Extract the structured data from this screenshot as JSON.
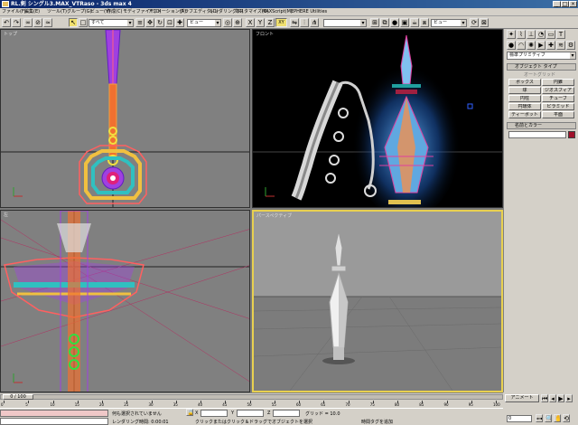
{
  "window": {
    "title": "RL.剣 シングル3.MAX_VTRaso - 3ds max 4"
  },
  "menu": [
    "ファイル(F)",
    "編集(E)",
    "ツール(T)",
    "グループ(G)",
    "ビュー(V)",
    "作成(C)",
    "モディファイヤ(O)",
    "アニメーション(A)",
    "グラフエディタ(D)",
    "レンダリング(R)",
    "カスタマイズ(U)",
    "MAXScript(M)",
    "EPHERE Utilities"
  ],
  "toolbar": {
    "selection_filter": "すべて",
    "ref_coord": "ビュー",
    "axis_x": "X",
    "axis_y": "Y",
    "axis_z": "Z",
    "axis_xy": "XY",
    "named_sel": "",
    "render_type": "ビュー"
  },
  "viewports": {
    "top_label": "トップ",
    "front_label": "フロント",
    "left_label": "左",
    "persp_label": "パースペクティブ"
  },
  "command_panel": {
    "category_dropdown": "標準プリミティブ",
    "rollout_object_type": "オブジェクト タイプ",
    "autogrid_label": "オートグリッド",
    "buttons": [
      "ボックス",
      "円錐",
      "球",
      "ジオスフィア",
      "円柱",
      "チューブ",
      "円環体",
      "ピラミッド",
      "ティーポット",
      "平面"
    ],
    "rollout_name_color": "名前とカラー"
  },
  "timeline": {
    "frame_indicator": "0 / 100",
    "ticks": [
      "0",
      "5",
      "10",
      "15",
      "20",
      "25",
      "30",
      "35",
      "40",
      "45",
      "50",
      "55",
      "60",
      "65",
      "70",
      "75",
      "80",
      "85",
      "90",
      "95",
      "100"
    ]
  },
  "status": {
    "selection_text": "何も選択されていません",
    "prompt_text": "レンダリング時間: 0:00:01",
    "click_prompt": "クリックまたはクリック＆ドラッグでオブジェクトを選択",
    "x_label": "X",
    "y_label": "Y",
    "z_label": "Z",
    "grid_label": "グリッド = 10.0",
    "add_time_tag": "時間タグを追加",
    "animate_label": "アニメート",
    "frame_value": "0"
  },
  "colors": {
    "active_border": "#e8d050",
    "accent": "#0a246a",
    "name_color_swatch": "#a0102a"
  }
}
